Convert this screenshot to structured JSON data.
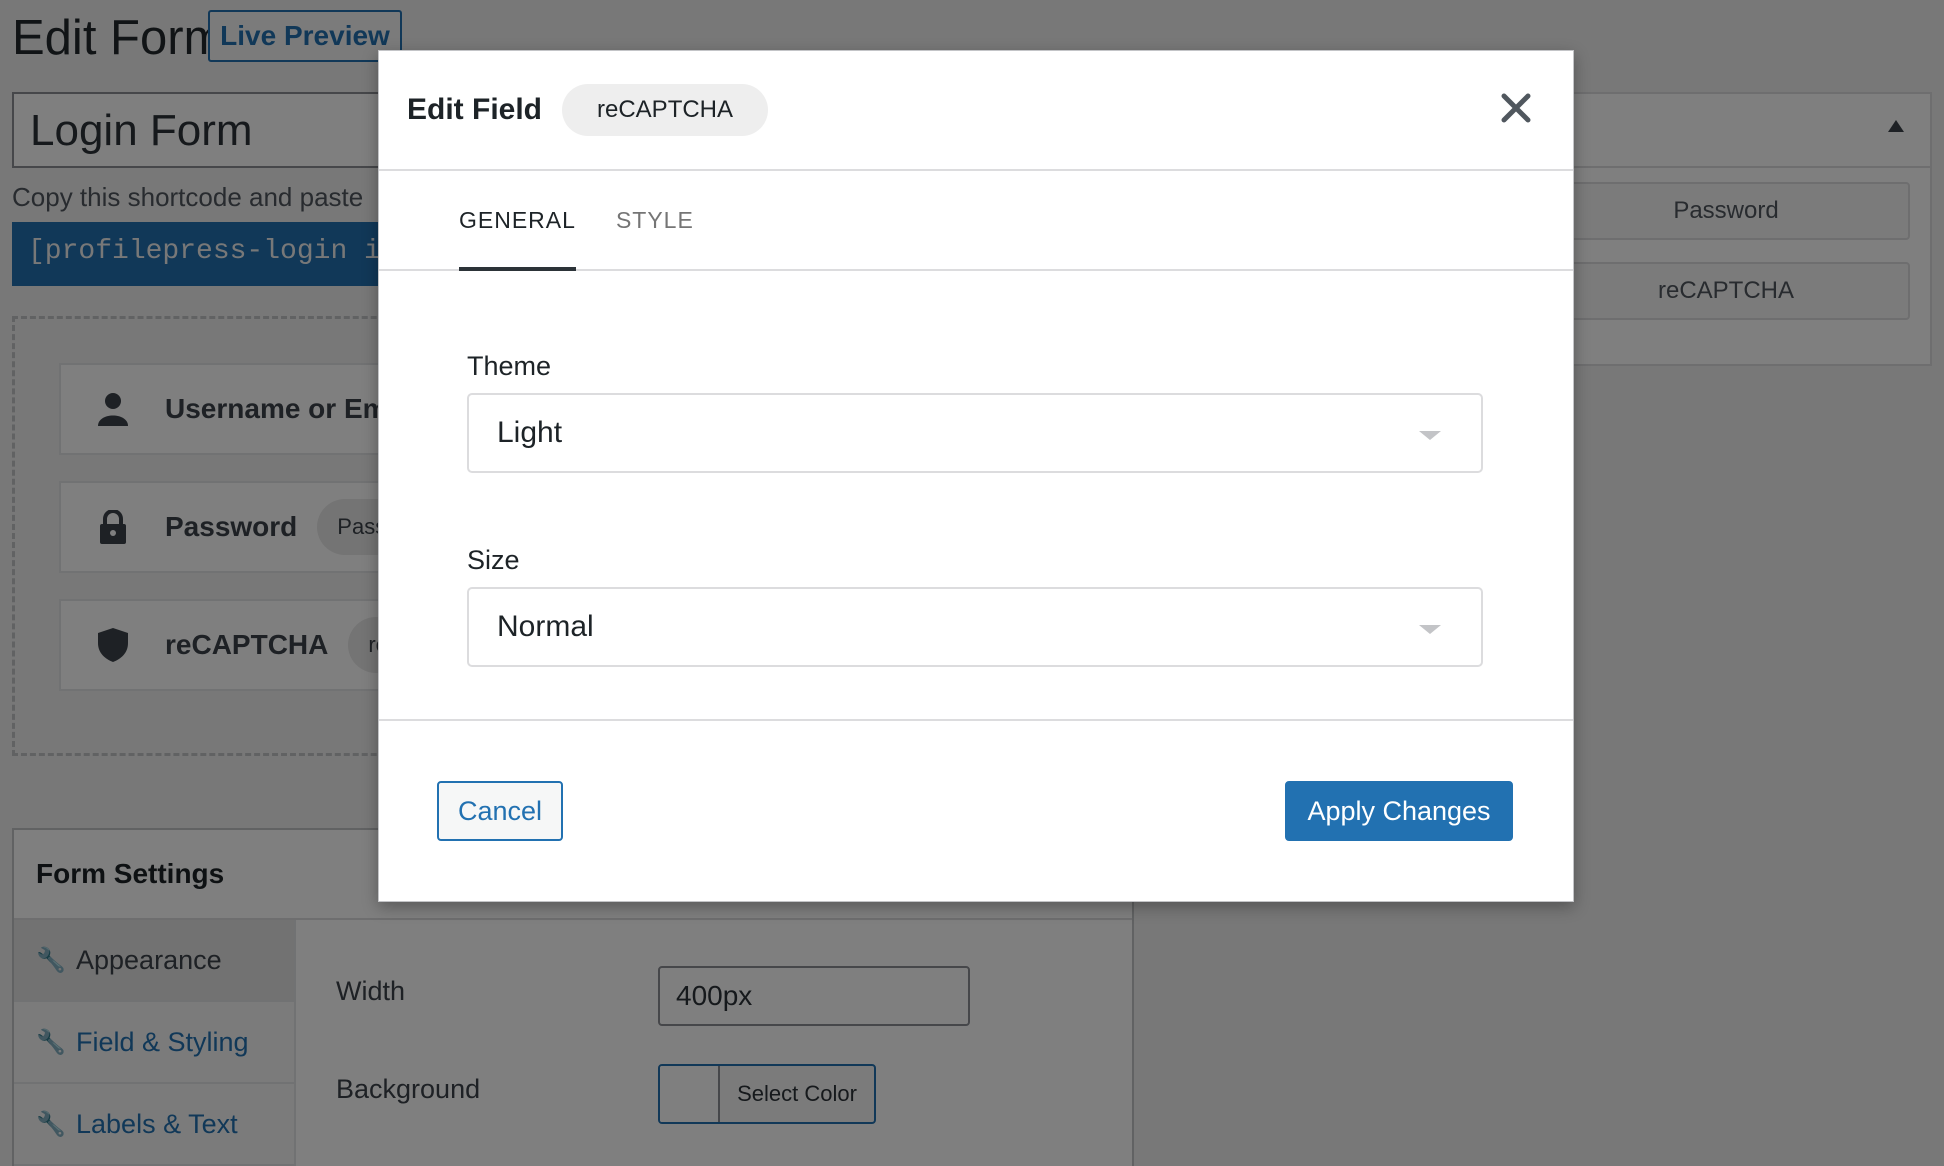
{
  "page": {
    "title": "Edit Form",
    "live_preview_label": "Live Preview",
    "form_name": "Login Form",
    "shortcode_instruction": "Copy this shortcode and paste",
    "shortcode": "[profilepress-login id=\""
  },
  "builder": {
    "fields": [
      {
        "label": "Username or Ema",
        "pill": "",
        "icon": "user-icon"
      },
      {
        "label": "Password",
        "pill": "Passw",
        "icon": "lock-icon"
      },
      {
        "label": "reCAPTCHA",
        "pill": "reC",
        "icon": "shield-icon"
      }
    ]
  },
  "available_fields": {
    "items": [
      "Password",
      "reCAPTCHA"
    ]
  },
  "form_settings": {
    "title": "Form Settings",
    "nav": [
      "Appearance",
      "Field & Styling",
      "Labels & Text"
    ],
    "width_label": "Width",
    "width_value": "400px",
    "background_label": "Background",
    "select_color_label": "Select Color"
  },
  "modal": {
    "title": "Edit Field",
    "badge": "reCAPTCHA",
    "tabs": [
      "GENERAL",
      "STYLE"
    ],
    "theme_label": "Theme",
    "theme_value": "Light",
    "size_label": "Size",
    "size_value": "Normal",
    "cancel_label": "Cancel",
    "apply_label": "Apply Changes"
  },
  "colors": {
    "accent": "#2271b1",
    "overlay": "rgba(0,0,0,0.5)"
  }
}
